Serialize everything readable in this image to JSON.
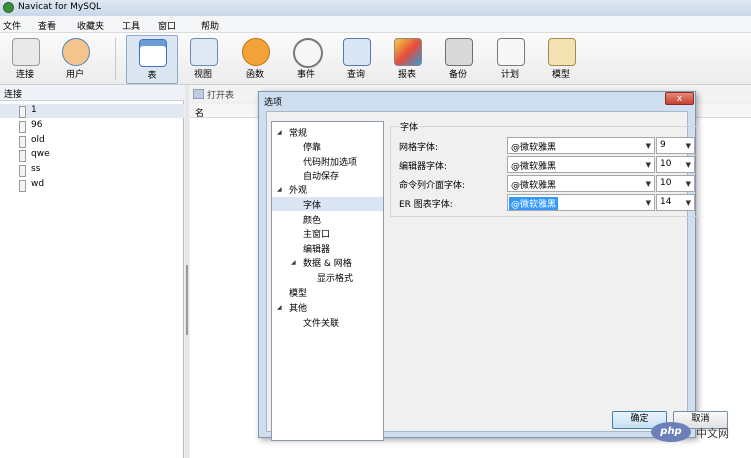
{
  "app": {
    "title": "Navicat for MySQL"
  },
  "menu": [
    "文件",
    "查看",
    "收藏夹",
    "工具",
    "窗口",
    "帮助"
  ],
  "toolbar": [
    {
      "label": "连接",
      "icon": "connection-icon"
    },
    {
      "label": "用户",
      "icon": "user-icon"
    },
    {
      "label": "表",
      "icon": "table-icon",
      "active": true
    },
    {
      "label": "视图",
      "icon": "view-icon"
    },
    {
      "label": "函数",
      "icon": "function-icon"
    },
    {
      "label": "事件",
      "icon": "event-icon"
    },
    {
      "label": "查询",
      "icon": "query-icon"
    },
    {
      "label": "报表",
      "icon": "report-icon"
    },
    {
      "label": "备份",
      "icon": "backup-icon"
    },
    {
      "label": "计划",
      "icon": "schedule-icon"
    },
    {
      "label": "模型",
      "icon": "model-icon"
    }
  ],
  "left_panel": {
    "header": "连接",
    "connections": [
      "1",
      "96",
      "old",
      "qwe",
      "ss",
      "wd"
    ]
  },
  "object_toolbar": {
    "open_table": "打开表"
  },
  "object_list": {
    "column_name": "名"
  },
  "dialog": {
    "title": "选项",
    "close_label": "x",
    "tree": {
      "general": "常规",
      "dock": "停靠",
      "code_options": "代码附加选项",
      "autosave": "自动保存",
      "appearance": "外观",
      "font": "字体",
      "color": "颜色",
      "main_window": "主窗口",
      "editor": "编辑器",
      "data_grid": "数据 & 网格",
      "display_format": "显示格式",
      "model": "模型",
      "other": "其他",
      "file_assoc": "文件关联"
    },
    "font_group": {
      "title": "字体",
      "rows": [
        {
          "label": "网格字体:",
          "font": "@微软雅黑",
          "size": "9"
        },
        {
          "label": "编辑器字体:",
          "font": "@微软雅黑",
          "size": "10"
        },
        {
          "label": "命令列介面字体:",
          "font": "@微软雅黑",
          "size": "10"
        },
        {
          "label": "ER 图表字体:",
          "font": "@微软雅黑",
          "size": "14"
        }
      ]
    },
    "ok_label": "确定",
    "cancel_label": "取消"
  },
  "watermark": {
    "logo": "php",
    "site": "中文网"
  },
  "colors": {
    "accent": "#3399ff",
    "dialog_frame": "#cfdff0",
    "close_button": "#c74231"
  }
}
